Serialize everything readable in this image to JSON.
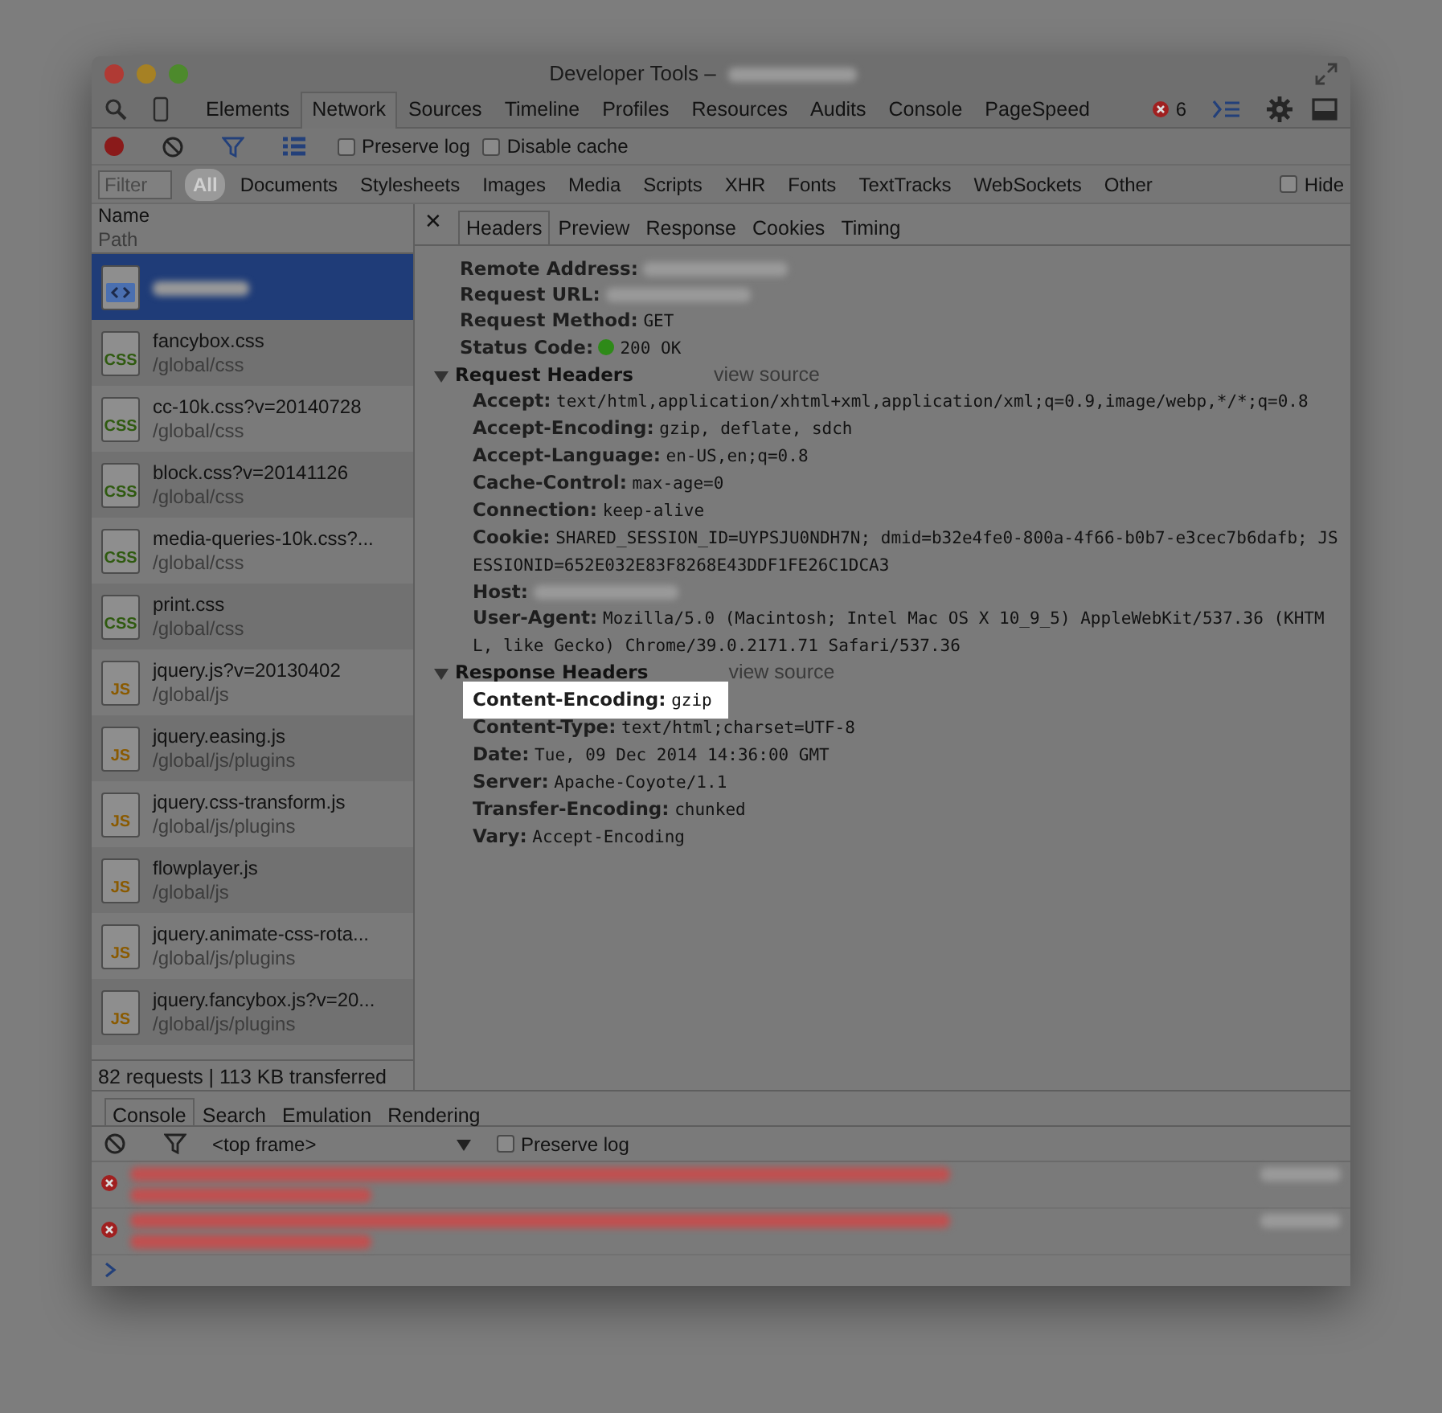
{
  "window": {
    "title": "Developer Tools –"
  },
  "main_tabs": [
    {
      "label": "Elements",
      "selected": false
    },
    {
      "label": "Network",
      "selected": true
    },
    {
      "label": "Sources",
      "selected": false
    },
    {
      "label": "Timeline",
      "selected": false
    },
    {
      "label": "Profiles",
      "selected": false
    },
    {
      "label": "Resources",
      "selected": false
    },
    {
      "label": "Audits",
      "selected": false
    },
    {
      "label": "Console",
      "selected": false
    },
    {
      "label": "PageSpeed",
      "selected": false
    }
  ],
  "error_count": "6",
  "network_toolbar": {
    "recording": true,
    "preserve_log": {
      "label": "Preserve log",
      "checked": false
    },
    "disable_cache": {
      "label": "Disable cache",
      "checked": false
    }
  },
  "filter": {
    "placeholder": "Filter"
  },
  "type_filters": [
    {
      "label": "All",
      "selected": true
    },
    {
      "label": "Documents",
      "selected": false
    },
    {
      "label": "Stylesheets",
      "selected": false
    },
    {
      "label": "Images",
      "selected": false
    },
    {
      "label": "Media",
      "selected": false
    },
    {
      "label": "Scripts",
      "selected": false
    },
    {
      "label": "XHR",
      "selected": false
    },
    {
      "label": "Fonts",
      "selected": false
    },
    {
      "label": "TextTracks",
      "selected": false
    },
    {
      "label": "WebSockets",
      "selected": false
    },
    {
      "label": "Other",
      "selected": false
    }
  ],
  "hide_option": {
    "label": "Hide",
    "checked": false
  },
  "request_columns": [
    "Name",
    "Path"
  ],
  "requests": [
    {
      "kind": "html",
      "selected": true
    },
    {
      "kind": "css",
      "icon_label": "CSS",
      "name": "fancybox.css",
      "path": "/global/css",
      "selected": false
    },
    {
      "kind": "css",
      "icon_label": "CSS",
      "name": "cc-10k.css?v=20140728",
      "path": "/global/css",
      "selected": false
    },
    {
      "kind": "css",
      "icon_label": "CSS",
      "name": "block.css?v=20141126",
      "path": "/global/css",
      "selected": false
    },
    {
      "kind": "css",
      "icon_label": "CSS",
      "name": "media-queries-10k.css?...",
      "path": "/global/css",
      "selected": false
    },
    {
      "kind": "css",
      "icon_label": "CSS",
      "name": "print.css",
      "path": "/global/css",
      "selected": false
    },
    {
      "kind": "js",
      "icon_label": "JS",
      "name": "jquery.js?v=20130402",
      "path": "/global/js",
      "selected": false
    },
    {
      "kind": "js",
      "icon_label": "JS",
      "name": "jquery.easing.js",
      "path": "/global/js/plugins",
      "selected": false
    },
    {
      "kind": "js",
      "icon_label": "JS",
      "name": "jquery.css-transform.js",
      "path": "/global/js/plugins",
      "selected": false
    },
    {
      "kind": "js",
      "icon_label": "JS",
      "name": "flowplayer.js",
      "path": "/global/js",
      "selected": false
    },
    {
      "kind": "js",
      "icon_label": "JS",
      "name": "jquery.animate-css-rota...",
      "path": "/global/js/plugins",
      "selected": false
    },
    {
      "kind": "js",
      "icon_label": "JS",
      "name": "jquery.fancybox.js?v=20...",
      "path": "/global/js/plugins",
      "selected": false
    }
  ],
  "status_bar": "82 requests | 113 KB transferred",
  "detail_close": "✕",
  "detail_tabs": [
    {
      "label": "Headers",
      "selected": true
    },
    {
      "label": "Preview",
      "selected": false
    },
    {
      "label": "Response",
      "selected": false
    },
    {
      "label": "Cookies",
      "selected": false
    },
    {
      "label": "Timing",
      "selected": false
    }
  ],
  "general": [
    {
      "kind": "blurred",
      "name": "Remote Address:"
    },
    {
      "kind": "blurred",
      "name": "Request URL:"
    },
    {
      "kind": "text",
      "name": "Request Method:",
      "value": "GET"
    },
    {
      "kind": "status",
      "name": "Status Code:",
      "value": "200 OK"
    }
  ],
  "header_sections": [
    {
      "title": "Request Headers",
      "expanded": true,
      "link": "view source",
      "headers": [
        {
          "kind": "text",
          "name": "Accept:",
          "value": "text/html,application/xhtml+xml,application/xml;q=0.9,image/webp,*/*;q=0.8",
          "highlighted": false
        },
        {
          "kind": "text",
          "name": "Accept-Encoding:",
          "value": "gzip, deflate, sdch",
          "highlighted": false
        },
        {
          "kind": "text",
          "name": "Accept-Language:",
          "value": "en-US,en;q=0.8",
          "highlighted": false
        },
        {
          "kind": "text",
          "name": "Cache-Control:",
          "value": "max-age=0",
          "highlighted": false
        },
        {
          "kind": "text",
          "name": "Connection:",
          "value": "keep-alive",
          "highlighted": false
        },
        {
          "kind": "text",
          "name": "Cookie:",
          "value": "SHARED_SESSION_ID=UYPSJU0NDH7N; dmid=b32e4fe0-800a-4f66-b0b7-e3cec7b6dafb; JSESSIONID=652E032E83F8268E43DDF1FE26C1DCA3",
          "highlighted": false
        },
        {
          "kind": "blurred",
          "name": "Host:",
          "highlighted": false
        },
        {
          "kind": "text",
          "name": "User-Agent:",
          "value": "Mozilla/5.0 (Macintosh; Intel Mac OS X 10_9_5) AppleWebKit/537.36 (KHTML, like Gecko) Chrome/39.0.2171.71 Safari/537.36",
          "highlighted": false
        }
      ]
    },
    {
      "title": "Response Headers",
      "expanded": true,
      "link": "view source",
      "headers": [
        {
          "kind": "text",
          "name": "Content-Encoding:",
          "value": "gzip",
          "highlighted": true
        },
        {
          "kind": "text",
          "name": "Content-Type:",
          "value": "text/html;charset=UTF-8",
          "highlighted": false
        },
        {
          "kind": "text",
          "name": "Date:",
          "value": "Tue, 09 Dec 2014 14:36:00 GMT",
          "highlighted": false
        },
        {
          "kind": "text",
          "name": "Server:",
          "value": "Apache-Coyote/1.1",
          "highlighted": false
        },
        {
          "kind": "text",
          "name": "Transfer-Encoding:",
          "value": "chunked",
          "highlighted": false
        },
        {
          "kind": "text",
          "name": "Vary:",
          "value": "Accept-Encoding",
          "highlighted": false
        }
      ]
    }
  ],
  "drawer_tabs": [
    {
      "label": "Console",
      "selected": true
    },
    {
      "label": "Search",
      "selected": false
    },
    {
      "label": "Emulation",
      "selected": false
    },
    {
      "label": "Rendering",
      "selected": false
    }
  ],
  "console_toolbar": {
    "frame": "<top frame>",
    "preserve_log": {
      "label": "Preserve log",
      "checked": false
    }
  },
  "messages": [
    {
      "kind": "error"
    },
    {
      "kind": "error"
    }
  ]
}
